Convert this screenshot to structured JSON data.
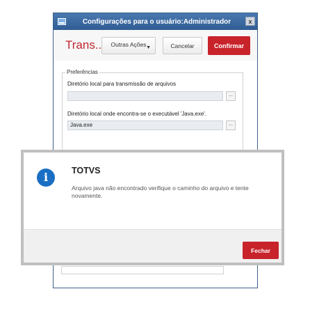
{
  "window": {
    "title": "Configurações para o usuário:Administrador",
    "close_glyph": "x"
  },
  "toolbar": {
    "title": "Trans...",
    "more_actions_label": "Outras Ações",
    "cancel_label": "Cancelar",
    "confirm_label": "Confirmar"
  },
  "preferences": {
    "legend": "Preferências",
    "transfer_dir_label": "Diretório local para transmissão de arquivos",
    "transfer_dir_value": "",
    "java_dir_label": "Diretório local onde encontra-se o executável 'Java.exe'.",
    "java_dir_value": "Java.exe",
    "browse_label": "..."
  },
  "dialog": {
    "icon": "info-icon",
    "title": "TOTVS",
    "message": "Arquivo java não encontrado verifique o caminho do arquivo e tente novamente.",
    "close_label": "Fechar"
  },
  "colors": {
    "accent_red": "#c8232b",
    "title_bar_blue": "#2f5c93",
    "info_blue": "#1a6fc4"
  }
}
